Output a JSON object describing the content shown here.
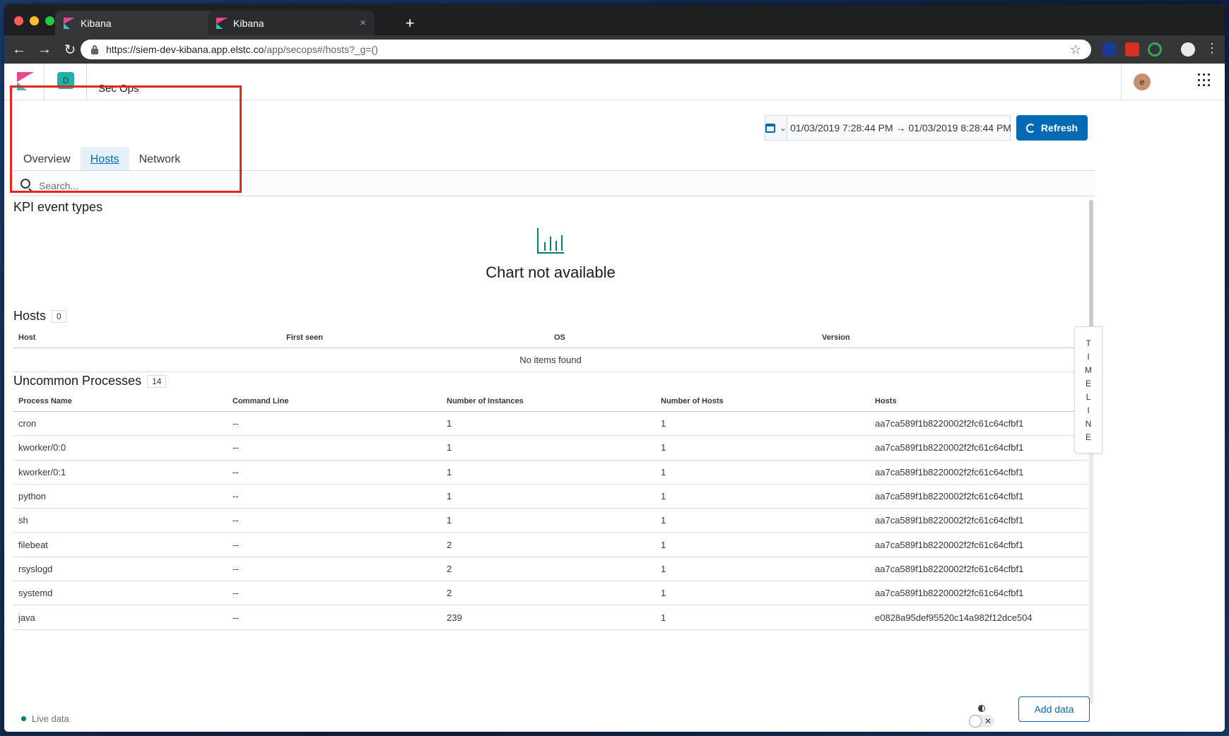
{
  "browser": {
    "tabs": [
      {
        "title": "Kibana"
      },
      {
        "title": "Kibana"
      }
    ],
    "new_tab_label": "+",
    "url_host": "https://siem-dev-kibana.app.elstc.co",
    "url_path": "/app/secops#/hosts?_g=()",
    "close_glyph": "×"
  },
  "header": {
    "space_initial": "D",
    "app_title": "Sec Ops",
    "user_initial": "e"
  },
  "datepicker": {
    "range": "01/03/2019 7:28:44 PM → 01/03/2019 8:28:44 PM"
  },
  "refresh_label": "Refresh",
  "tabs": [
    {
      "label": "Overview"
    },
    {
      "label": "Hosts"
    },
    {
      "label": "Network"
    }
  ],
  "search": {
    "placeholder": "Search..."
  },
  "kpi": {
    "title": "KPI event types",
    "empty_message": "Chart not available"
  },
  "hosts": {
    "title": "Hosts",
    "count": "0",
    "columns": [
      "Host",
      "First seen",
      "OS",
      "Version"
    ],
    "empty_text": "No items found"
  },
  "processes": {
    "title": "Uncommon Processes",
    "count": "14",
    "columns": [
      "Process Name",
      "Command Line",
      "Number of Instances",
      "Number of Hosts",
      "Hosts"
    ],
    "rows": [
      [
        "cron",
        "--",
        "1",
        "1",
        "aa7ca589f1b8220002f2fc61c64cfbf1"
      ],
      [
        "kworker/0:0",
        "--",
        "1",
        "1",
        "aa7ca589f1b8220002f2fc61c64cfbf1"
      ],
      [
        "kworker/0:1",
        "--",
        "1",
        "1",
        "aa7ca589f1b8220002f2fc61c64cfbf1"
      ],
      [
        "python",
        "--",
        "1",
        "1",
        "aa7ca589f1b8220002f2fc61c64cfbf1"
      ],
      [
        "sh",
        "--",
        "1",
        "1",
        "aa7ca589f1b8220002f2fc61c64cfbf1"
      ],
      [
        "filebeat",
        "--",
        "2",
        "1",
        "aa7ca589f1b8220002f2fc61c64cfbf1"
      ],
      [
        "rsyslogd",
        "--",
        "2",
        "1",
        "aa7ca589f1b8220002f2fc61c64cfbf1"
      ],
      [
        "systemd",
        "--",
        "2",
        "1",
        "aa7ca589f1b8220002f2fc61c64cfbf1"
      ],
      [
        "java",
        "--",
        "239",
        "1",
        "e0828a95def95520c14a982f12dce504"
      ]
    ]
  },
  "timeline_letters": [
    "T",
    "I",
    "M",
    "E",
    "L",
    "I",
    "N",
    "E"
  ],
  "footer": {
    "live_label": "Live data",
    "add_data_label": "Add data",
    "toggle_x": "✕"
  },
  "colors": {
    "primary": "#006bb4",
    "highlight": "#e8241c",
    "success": "#017d73"
  }
}
